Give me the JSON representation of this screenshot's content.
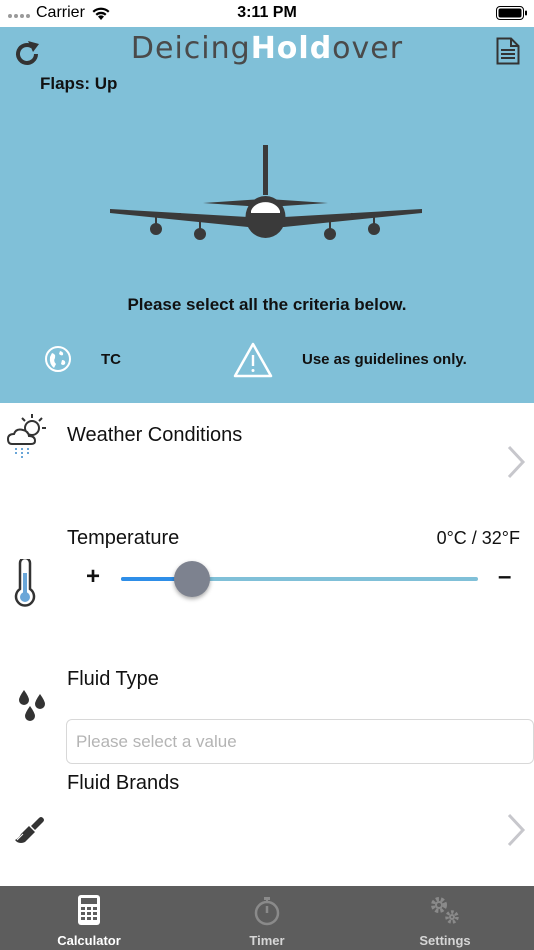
{
  "status_bar": {
    "carrier": "Carrier",
    "time": "3:11 PM"
  },
  "header": {
    "title_part1": "Deicing",
    "title_part2": "Hold",
    "title_part3": "over",
    "flaps": "Flaps: Up"
  },
  "hero": {
    "instruction": "Please select all the criteria below.",
    "region_code": "TC",
    "disclaimer": "Use as guidelines only."
  },
  "weather": {
    "label": "Weather Conditions"
  },
  "temperature": {
    "label": "Temperature",
    "value_text": "0°C / 32°F",
    "plus_label": "+",
    "minus_label": "–",
    "slider_fraction": 0.2
  },
  "fluid_type": {
    "label": "Fluid Type",
    "placeholder": "Please select a value",
    "value": ""
  },
  "fluid_brands": {
    "label": "Fluid Brands"
  },
  "tabs": [
    {
      "label": "Calculator",
      "icon": "calculator-icon",
      "active": true
    },
    {
      "label": "Timer",
      "icon": "stopwatch-icon",
      "active": false
    },
    {
      "label": "Settings",
      "icon": "gears-icon",
      "active": false
    }
  ],
  "colors": {
    "hero_bg": "#80c0d8",
    "slider_fill": "#2e8ee8",
    "slider_thumb": "#7d828f",
    "tab_bar": "#5d5d5d"
  }
}
